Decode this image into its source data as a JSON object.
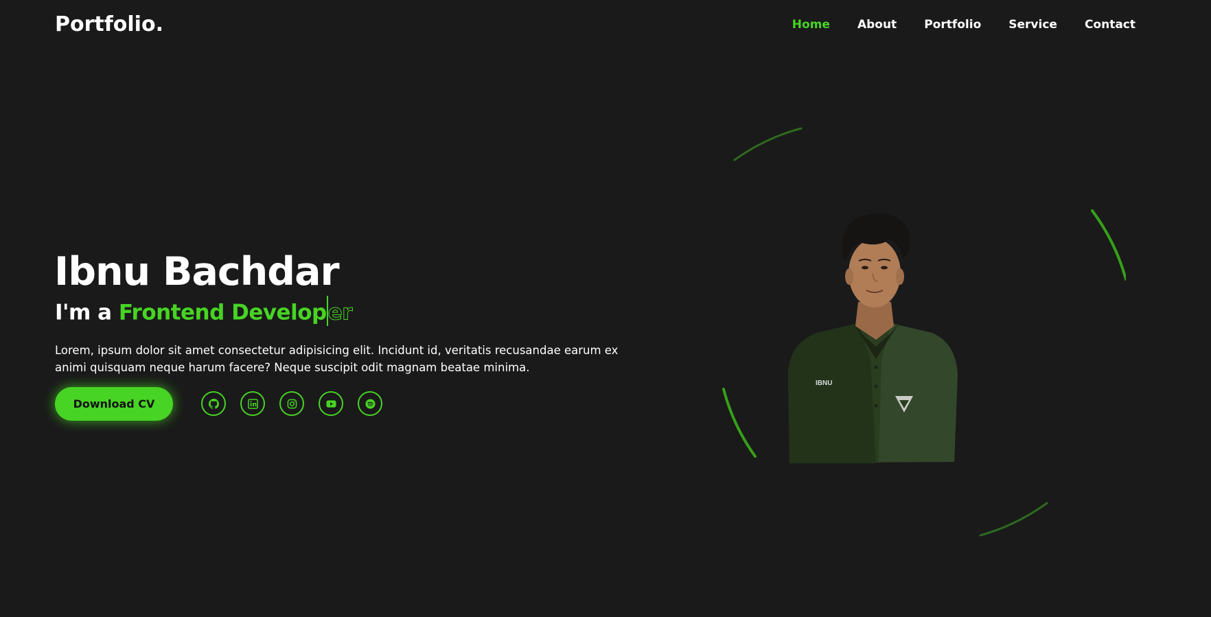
{
  "header": {
    "logo": "Portfolio.",
    "nav": [
      {
        "label": "Home",
        "active": true
      },
      {
        "label": "About"
      },
      {
        "label": "Portfolio"
      },
      {
        "label": "Service"
      },
      {
        "label": "Contact"
      }
    ]
  },
  "hero": {
    "name": "Ibnu Bachdar",
    "role_prefix": "I'm a ",
    "role_typed": "Frontend Develop",
    "role_remaining": "er",
    "description": "Lorem, ipsum dolor sit amet consectetur adipisicing elit. Incidunt id, veritatis recusandae earum ex animi quisquam neque harum facere? Neque suscipit odit magnam beatae minima.",
    "cta_label": "Download CV",
    "socials": [
      {
        "icon": "github-icon"
      },
      {
        "icon": "linkedin-icon"
      },
      {
        "icon": "instagram-icon"
      },
      {
        "icon": "youtube-icon"
      },
      {
        "icon": "spotify-icon"
      }
    ],
    "portrait_badge": "IBNU"
  },
  "colors": {
    "background": "#1a1a1a",
    "accent": "#47d424",
    "text": "#ffffff"
  }
}
